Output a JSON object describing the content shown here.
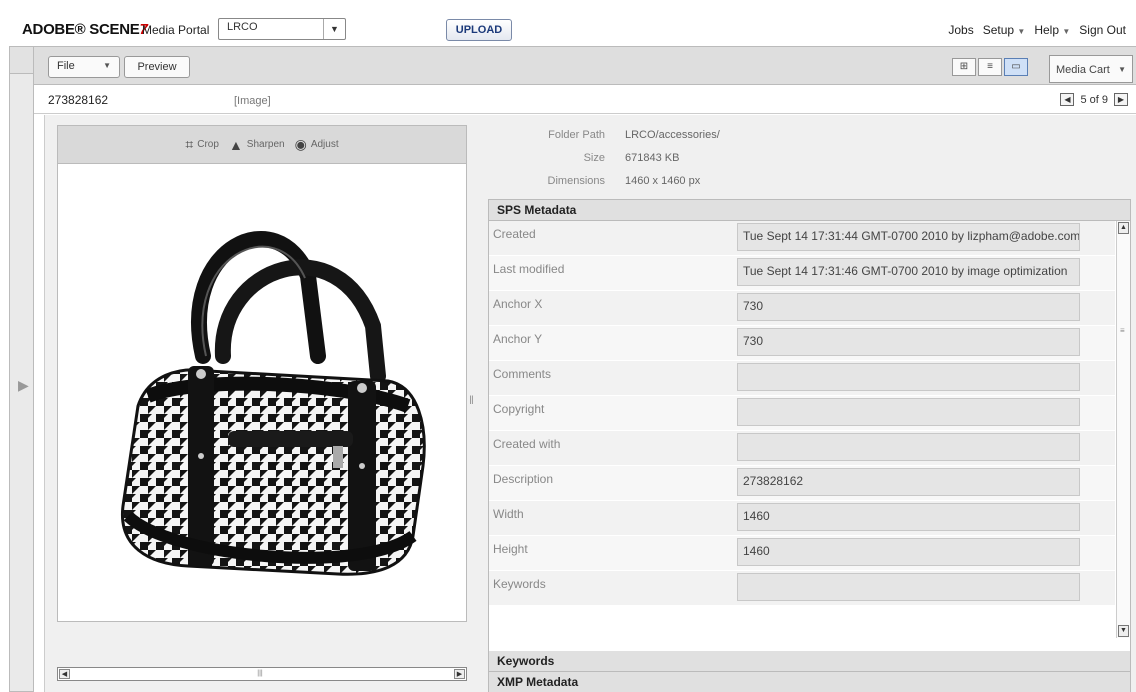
{
  "app": {
    "brand": "ADOBE® SCENE",
    "brand_suffix": "7",
    "portal_label": "Media Portal",
    "portal_value": "LRCO",
    "upload_label": "UPLOAD",
    "nav": {
      "jobs": "Jobs",
      "setup": "Setup",
      "help": "Help",
      "sign_out": "Sign Out"
    }
  },
  "toolbar": {
    "file_label": "File",
    "preview_label": "Preview",
    "view_modes": [
      "grid-view-icon",
      "list-view-icon",
      "detail-view-icon"
    ],
    "media_cart_label": "Media Cart"
  },
  "asset": {
    "id": "273828162",
    "type": "[Image]",
    "pager": "5 of 9"
  },
  "image_tools": {
    "crop": "Crop",
    "sharpen": "Sharpen",
    "adjust": "Adjust"
  },
  "file_info": {
    "folder_path_label": "Folder Path",
    "folder_path_value": "LRCO/accessories/",
    "size_label": "Size",
    "size_value": "671843 KB",
    "dimensions_label": "Dimensions",
    "dimensions_value": "1460 x 1460 px"
  },
  "metadata": {
    "section_sps": "SPS Metadata",
    "section_keywords": "Keywords",
    "section_xmp": "XMP Metadata",
    "rows": [
      {
        "label": "Created",
        "value": "Tue Sept 14 17:31:44 GMT-0700 2010 by lizpham@adobe.com"
      },
      {
        "label": "Last modified",
        "value": "Tue Sept 14 17:31:46 GMT-0700 2010 by image optimization"
      },
      {
        "label": "Anchor X",
        "value": "730"
      },
      {
        "label": "Anchor Y",
        "value": "730"
      },
      {
        "label": "Comments",
        "value": ""
      },
      {
        "label": "Copyright",
        "value": ""
      },
      {
        "label": "Created with",
        "value": ""
      },
      {
        "label": "Description",
        "value": "273828162"
      },
      {
        "label": "Width",
        "value": "1460"
      },
      {
        "label": "Height",
        "value": "1460"
      },
      {
        "label": "Keywords",
        "value": ""
      }
    ]
  },
  "colors": {
    "upload_text": "#1c3a7a",
    "brand_accent": "#cc0000",
    "section_header_bg": "#e0e0e0"
  }
}
